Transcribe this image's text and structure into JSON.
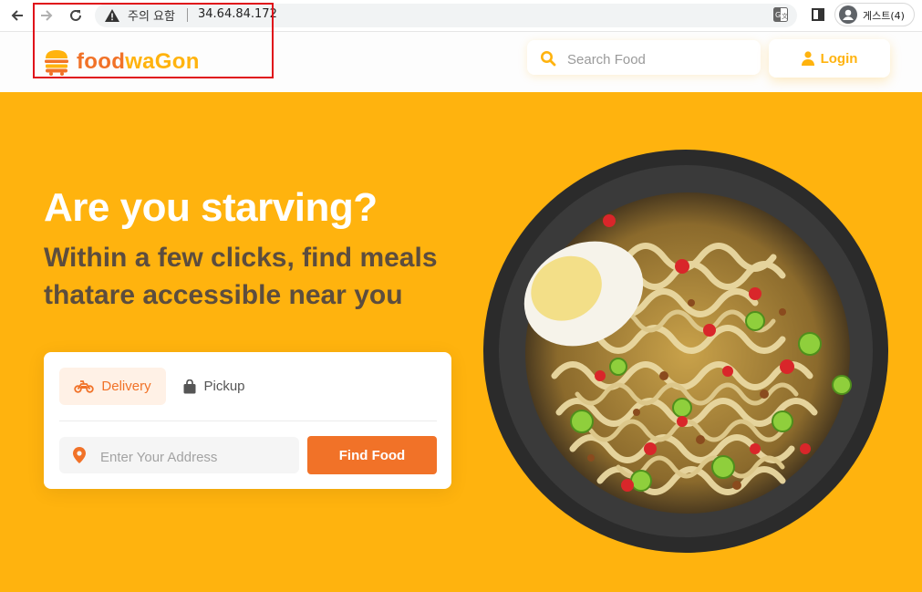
{
  "browser": {
    "security_label": "주의 요함",
    "url": "34.64.84.172",
    "profile_label": "게스트(4)"
  },
  "header": {
    "logo_primary": "food",
    "logo_secondary": "waGon",
    "search_placeholder": "Search Food",
    "login_label": "Login"
  },
  "hero": {
    "title": "Are you starving?",
    "subtitle": "Within a few clicks, find meals thatare accessible near you",
    "tabs": [
      {
        "label": "Delivery",
        "icon": "motorcycle-icon",
        "active": true
      },
      {
        "label": "Pickup",
        "icon": "shopping-bag-icon",
        "active": false
      }
    ],
    "address_placeholder": "Enter Your Address",
    "find_button_label": "Find Food"
  },
  "colors": {
    "brand_orange": "#f17228",
    "brand_yellow": "#ffb30e",
    "subtitle_brown": "#5c4d3e",
    "annotation_red": "#e0101a"
  }
}
